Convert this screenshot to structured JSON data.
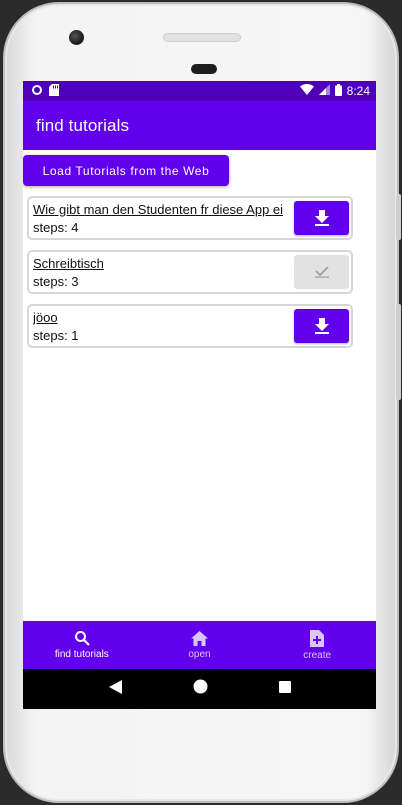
{
  "statusbar": {
    "time": "8:24"
  },
  "appbar": {
    "title": "find tutorials"
  },
  "load_button": {
    "label": "Load Tutorials from the Web"
  },
  "tutorials": [
    {
      "title": "Wie gibt man den Studenten fr diese App ei",
      "steps": "steps: 4",
      "status": "download"
    },
    {
      "title": "Schreibtisch",
      "steps": "steps: 3",
      "status": "downloaded"
    },
    {
      "title": "jöoo",
      "steps": "steps: 1",
      "status": "download"
    }
  ],
  "bottom_nav": [
    {
      "label": "find tutorials",
      "icon": "search-icon",
      "active": true
    },
    {
      "label": "open",
      "icon": "home-icon",
      "active": false
    },
    {
      "label": "create",
      "icon": "note-add-icon",
      "active": false
    }
  ],
  "colors": {
    "primary": "#6200ee",
    "status": "#4e00b8",
    "disabled": "#e2e2e2"
  }
}
